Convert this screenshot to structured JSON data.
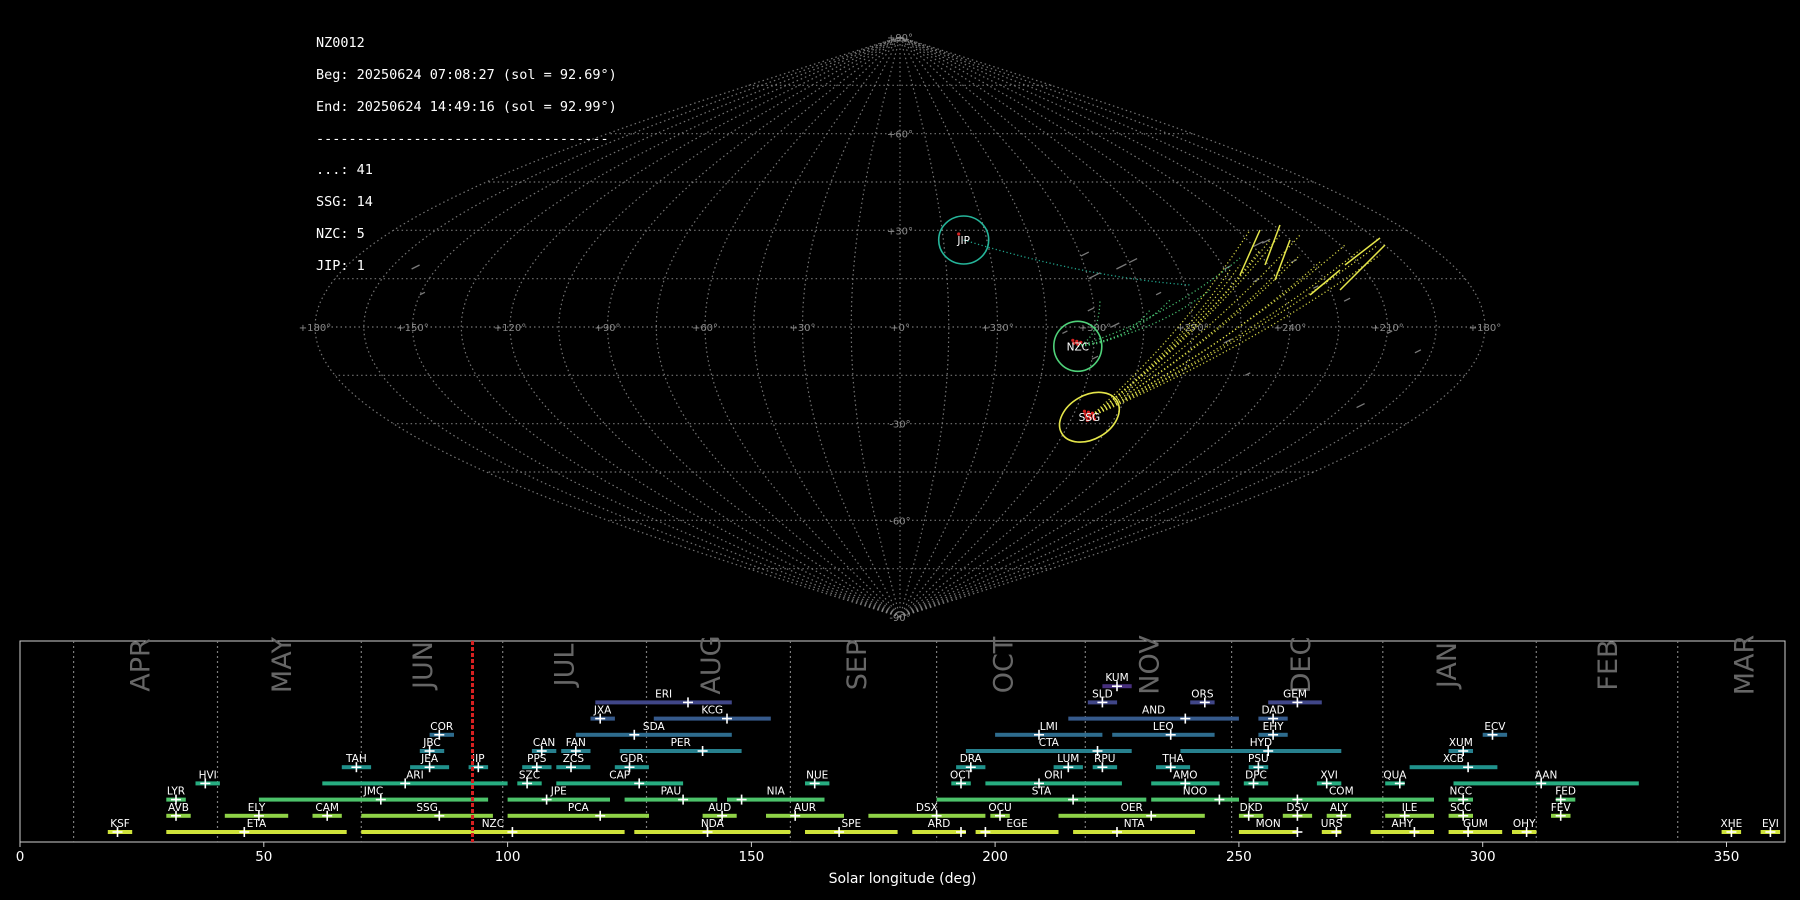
{
  "info": {
    "station": "NZ0012",
    "beg": "Beg: 20250624 07:08:27 (sol = 92.69°)",
    "end": "End: 20250624 14:49:16 (sol = 92.99°)",
    "separator": "------------------------------------",
    "counts": [
      {
        "code": "...",
        "n": 41
      },
      {
        "code": "SSG",
        "n": 14
      },
      {
        "code": "NZC",
        "n": 5
      },
      {
        "code": "JIP",
        "n": 1
      }
    ]
  },
  "colors": {
    "background": "#000000",
    "grid": "#8a8a8a",
    "marker_sol": "#d62020",
    "sporadic": "#7a7a7a",
    "ssg": "#e5e64a",
    "nzc": "#4fd27a",
    "jip": "#25b59a"
  },
  "chart_data": [
    {
      "type": "scatter",
      "projection": "sinusoidal",
      "lon_tick_labels": [
        "+180°",
        "+150°",
        "+120°",
        "+90°",
        "+60°",
        "+30°",
        "+0°",
        "+330°",
        "+300°",
        "+270°",
        "+240°",
        "+210°",
        "+180°"
      ],
      "lat_tick_labels": [
        "+90°",
        "+60°",
        "+30°",
        "+0°",
        "-30°",
        "-60°",
        "-90°"
      ],
      "showers": [
        {
          "code": "JIP",
          "lon": 338,
          "lat": 27,
          "color": "#25b59a"
        },
        {
          "code": "NZC",
          "lon": 305,
          "lat": -6,
          "color": "#4fd27a"
        },
        {
          "code": "SSG",
          "lon": 294,
          "lat": -28,
          "color": "#e5e64a"
        }
      ]
    },
    {
      "type": "bar",
      "orientation": "horizontal-ranges",
      "xlabel": "Solar longitude (deg)",
      "xlim": [
        0,
        362
      ],
      "xticks": [
        0,
        50,
        100,
        150,
        200,
        250,
        300,
        350
      ],
      "current_sol": 92.8,
      "month_boundaries": [
        11,
        40.5,
        70,
        99,
        128.5,
        158,
        188,
        218.5,
        248.5,
        279.5,
        311,
        340
      ],
      "months": [
        {
          "label": "APR",
          "x": 25
        },
        {
          "label": "MAY",
          "x": 54
        },
        {
          "label": "JUN",
          "x": 83
        },
        {
          "label": "JUL",
          "x": 112
        },
        {
          "label": "AUG",
          "x": 142
        },
        {
          "label": "SEP",
          "x": 172
        },
        {
          "label": "OCT",
          "x": 202
        },
        {
          "label": "NOV",
          "x": 232
        },
        {
          "label": "DEC",
          "x": 263
        },
        {
          "label": "JAN",
          "x": 293
        },
        {
          "label": "FEB",
          "x": 326
        },
        {
          "label": "MAR",
          "x": 354
        }
      ],
      "showers": [
        {
          "code": "KUM",
          "start": 222,
          "end": 228,
          "peak": 225,
          "row": 10
        },
        {
          "code": "ERI",
          "start": 118,
          "end": 146,
          "peak": 137,
          "row": 9
        },
        {
          "code": "SLD",
          "start": 219,
          "end": 225,
          "peak": 222,
          "row": 9
        },
        {
          "code": "ORS",
          "start": 240,
          "end": 245,
          "peak": 243,
          "row": 9
        },
        {
          "code": "GEM",
          "start": 256,
          "end": 267,
          "peak": 262,
          "row": 9
        },
        {
          "code": "JXA",
          "start": 117,
          "end": 122,
          "peak": 119,
          "row": 8
        },
        {
          "code": "KCG",
          "start": 130,
          "end": 154,
          "peak": 145,
          "row": 8
        },
        {
          "code": "AND",
          "start": 215,
          "end": 250,
          "peak": 239,
          "row": 8
        },
        {
          "code": "DAD",
          "start": 254,
          "end": 260,
          "peak": 257,
          "row": 8
        },
        {
          "code": "COR",
          "start": 84,
          "end": 89,
          "peak": 86,
          "row": 7
        },
        {
          "code": "SDA",
          "start": 114,
          "end": 146,
          "peak": 126,
          "row": 7
        },
        {
          "code": "LMI",
          "start": 200,
          "end": 222,
          "peak": 209,
          "row": 7
        },
        {
          "code": "LEO",
          "start": 224,
          "end": 245,
          "peak": 236,
          "row": 7
        },
        {
          "code": "EHY",
          "start": 254,
          "end": 260,
          "peak": 257,
          "row": 7
        },
        {
          "code": "ECV",
          "start": 300,
          "end": 305,
          "peak": 302,
          "row": 7
        },
        {
          "code": "JBC",
          "start": 82,
          "end": 87,
          "peak": 84,
          "row": 6
        },
        {
          "code": "CAN",
          "start": 105,
          "end": 110,
          "peak": 107,
          "row": 6
        },
        {
          "code": "FAN",
          "start": 111,
          "end": 117,
          "peak": 114,
          "row": 6
        },
        {
          "code": "PER",
          "start": 123,
          "end": 148,
          "peak": 140,
          "row": 6
        },
        {
          "code": "CTA",
          "start": 194,
          "end": 228,
          "peak": 221,
          "row": 6
        },
        {
          "code": "HYD",
          "start": 238,
          "end": 271,
          "peak": 256,
          "row": 6
        },
        {
          "code": "XUM",
          "start": 293,
          "end": 298,
          "peak": 296,
          "row": 6
        },
        {
          "code": "TAH",
          "start": 66,
          "end": 72,
          "peak": 69,
          "row": 5
        },
        {
          "code": "JEA",
          "start": 80,
          "end": 88,
          "peak": 84,
          "row": 5
        },
        {
          "code": "JIP",
          "start": 92,
          "end": 96,
          "peak": 94,
          "row": 5
        },
        {
          "code": "PPS",
          "start": 103,
          "end": 109,
          "peak": 106,
          "row": 5
        },
        {
          "code": "ZCS",
          "start": 110,
          "end": 117,
          "peak": 113,
          "row": 5
        },
        {
          "code": "GDR",
          "start": 122,
          "end": 129,
          "peak": 125,
          "row": 5
        },
        {
          "code": "DRA",
          "start": 192,
          "end": 198,
          "peak": 195,
          "row": 5
        },
        {
          "code": "LUM",
          "start": 212,
          "end": 218,
          "peak": 215,
          "row": 5
        },
        {
          "code": "RPU",
          "start": 220,
          "end": 225,
          "peak": 222,
          "row": 5
        },
        {
          "code": "THA",
          "start": 233,
          "end": 240,
          "peak": 236,
          "row": 5
        },
        {
          "code": "PSU",
          "start": 252,
          "end": 256,
          "peak": 254,
          "row": 5
        },
        {
          "code": "XCB",
          "start": 285,
          "end": 303,
          "peak": 297,
          "row": 5
        },
        {
          "code": "HVI",
          "start": 36,
          "end": 41,
          "peak": 38,
          "row": 4
        },
        {
          "code": "ARI",
          "start": 62,
          "end": 100,
          "peak": 79,
          "row": 4
        },
        {
          "code": "SZC",
          "start": 102,
          "end": 107,
          "peak": 104,
          "row": 4
        },
        {
          "code": "CAP",
          "start": 110,
          "end": 136,
          "peak": 127,
          "row": 4
        },
        {
          "code": "NUE",
          "start": 161,
          "end": 166,
          "peak": 163,
          "row": 4
        },
        {
          "code": "OCT",
          "start": 191,
          "end": 195,
          "peak": 193,
          "row": 4
        },
        {
          "code": "ORI",
          "start": 198,
          "end": 226,
          "peak": 209,
          "row": 4
        },
        {
          "code": "AMO",
          "start": 232,
          "end": 246,
          "peak": 239,
          "row": 4
        },
        {
          "code": "DPC",
          "start": 251,
          "end": 256,
          "peak": 253,
          "row": 4
        },
        {
          "code": "XVI",
          "start": 266,
          "end": 271,
          "peak": 268,
          "row": 4
        },
        {
          "code": "QUA",
          "start": 280,
          "end": 284,
          "peak": 283,
          "row": 4
        },
        {
          "code": "AAN",
          "start": 294,
          "end": 332,
          "peak": 312,
          "row": 4
        },
        {
          "code": "LYR",
          "start": 30,
          "end": 34,
          "peak": 32,
          "row": 3
        },
        {
          "code": "JMC",
          "start": 49,
          "end": 96,
          "peak": 74,
          "row": 3
        },
        {
          "code": "JPE",
          "start": 100,
          "end": 121,
          "peak": 108,
          "row": 3
        },
        {
          "code": "PAU",
          "start": 124,
          "end": 143,
          "peak": 136,
          "row": 3
        },
        {
          "code": "NIA",
          "start": 145,
          "end": 165,
          "peak": 148,
          "row": 3
        },
        {
          "code": "STA",
          "start": 188,
          "end": 231,
          "peak": 216,
          "row": 3
        },
        {
          "code": "NOO",
          "start": 232,
          "end": 250,
          "peak": 246,
          "row": 3
        },
        {
          "code": "COM",
          "start": 252,
          "end": 290,
          "peak": 262,
          "row": 3
        },
        {
          "code": "NCC",
          "start": 293,
          "end": 298,
          "peak": 296,
          "row": 3
        },
        {
          "code": "FED",
          "start": 315,
          "end": 319,
          "peak": 316,
          "row": 3
        },
        {
          "code": "AVB",
          "start": 30,
          "end": 35,
          "peak": 32,
          "row": 2
        },
        {
          "code": "ELY",
          "start": 42,
          "end": 55,
          "peak": 49,
          "row": 2
        },
        {
          "code": "CAM",
          "start": 60,
          "end": 66,
          "peak": 63,
          "row": 2
        },
        {
          "code": "SSG",
          "start": 70,
          "end": 97,
          "peak": 86,
          "row": 2
        },
        {
          "code": "PCA",
          "start": 100,
          "end": 129,
          "peak": 119,
          "row": 2
        },
        {
          "code": "AUD",
          "start": 140,
          "end": 147,
          "peak": 144,
          "row": 2
        },
        {
          "code": "AUR",
          "start": 153,
          "end": 169,
          "peak": 159,
          "row": 2
        },
        {
          "code": "DSX",
          "start": 174,
          "end": 198,
          "peak": 188,
          "row": 2
        },
        {
          "code": "OCU",
          "start": 199,
          "end": 203,
          "peak": 201,
          "row": 2
        },
        {
          "code": "OER",
          "start": 213,
          "end": 243,
          "peak": 232,
          "row": 2
        },
        {
          "code": "DKD",
          "start": 250,
          "end": 255,
          "peak": 252,
          "row": 2
        },
        {
          "code": "DSV",
          "start": 259,
          "end": 265,
          "peak": 262,
          "row": 2
        },
        {
          "code": "ALY",
          "start": 268,
          "end": 273,
          "peak": 271,
          "row": 2
        },
        {
          "code": "ILE",
          "start": 280,
          "end": 290,
          "peak": 284,
          "row": 2
        },
        {
          "code": "SCC",
          "start": 293,
          "end": 298,
          "peak": 296,
          "row": 2
        },
        {
          "code": "FEV",
          "start": 314,
          "end": 318,
          "peak": 316,
          "row": 2
        },
        {
          "code": "KSF",
          "start": 18,
          "end": 23,
          "peak": 20,
          "row": 1
        },
        {
          "code": "ETA",
          "start": 30,
          "end": 67,
          "peak": 46,
          "row": 1
        },
        {
          "code": "NZC",
          "start": 70,
          "end": 124,
          "peak": 101,
          "row": 1
        },
        {
          "code": "NDA",
          "start": 126,
          "end": 158,
          "peak": 141,
          "row": 1
        },
        {
          "code": "SPE",
          "start": 161,
          "end": 180,
          "peak": 168,
          "row": 1
        },
        {
          "code": "ARD",
          "start": 183,
          "end": 194,
          "peak": 193,
          "row": 1
        },
        {
          "code": "EGE",
          "start": 196,
          "end": 213,
          "peak": 198,
          "row": 1
        },
        {
          "code": "NTA",
          "start": 216,
          "end": 241,
          "peak": 225,
          "row": 1
        },
        {
          "code": "MON",
          "start": 250,
          "end": 262,
          "peak": 262,
          "row": 1
        },
        {
          "code": "URS",
          "start": 267,
          "end": 271,
          "peak": 270,
          "row": 1
        },
        {
          "code": "AHY",
          "start": 277,
          "end": 290,
          "peak": 286,
          "row": 1
        },
        {
          "code": "GUM",
          "start": 293,
          "end": 304,
          "peak": 297,
          "row": 1
        },
        {
          "code": "OHY",
          "start": 306,
          "end": 311,
          "peak": 309,
          "row": 1
        },
        {
          "code": "XHE",
          "start": 349,
          "end": 353,
          "peak": 351,
          "row": 1
        },
        {
          "code": "EVI",
          "start": 357,
          "end": 361,
          "peak": 359,
          "row": 1
        }
      ]
    }
  ]
}
